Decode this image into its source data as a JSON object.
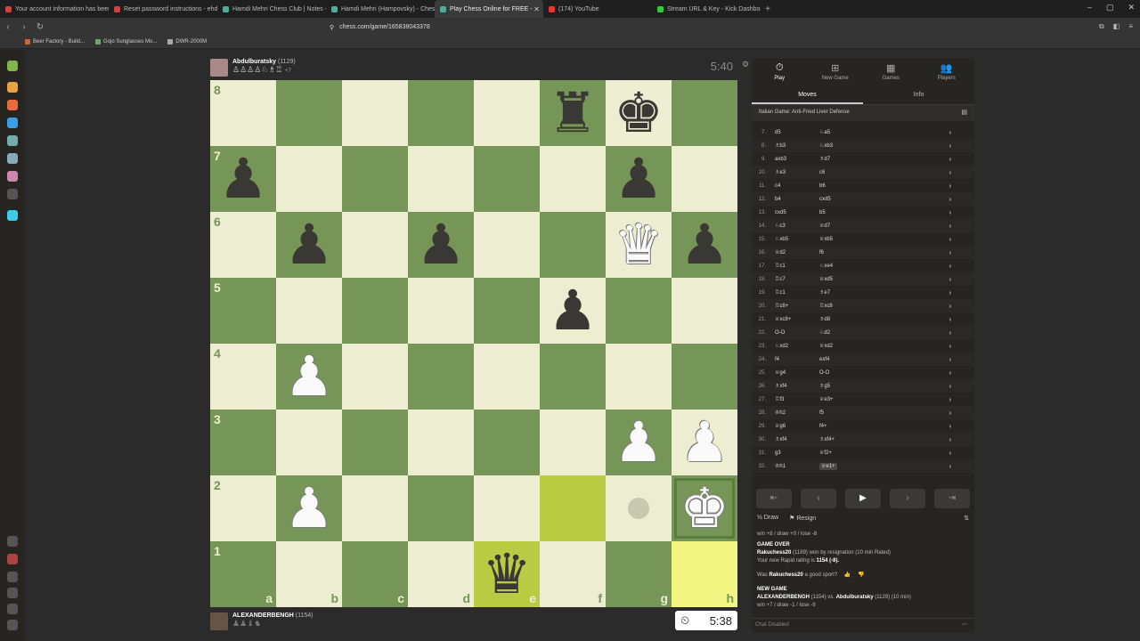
{
  "tabs": [
    {
      "label": "Your account information has been c",
      "color": "#c44"
    },
    {
      "label": "Reset password instructions - ehdi",
      "color": "#c44"
    },
    {
      "label": "Hamdi Mehri Chess Club | Notes - C",
      "color": "#5a9"
    },
    {
      "label": "Hamdi Mehri (Hampovsky) - Chess.",
      "color": "#5a9"
    },
    {
      "label": "Play Chess Online for FREE -",
      "color": "#5a9",
      "active": true
    },
    {
      "label": "(174) YouTube",
      "color": "#e33"
    },
    {
      "label": "Stream URL & Key - Kick Dashboard",
      "color": "#3c3"
    }
  ],
  "address": {
    "url": "chess.com/game/165838043378"
  },
  "bookmarks": [
    {
      "label": "Beer Factory - Build...",
      "color": "#c63"
    },
    {
      "label": "Gojo Sunglasses Mo...",
      "color": "#6a6"
    },
    {
      "label": "DWR-2000M",
      "color": "#aaa"
    }
  ],
  "top_player": {
    "name": "Abdulburatsky",
    "rating": "(1129)",
    "captured": "♙♙♙♙♘♗♖",
    "material": "+7",
    "clock": "5:40"
  },
  "bottom_player": {
    "name": "ALEXANDERBENGH",
    "rating": "(1154)",
    "captured": "♟♟♝♞",
    "clock": "5:38"
  },
  "board": {
    "files": [
      "a",
      "b",
      "c",
      "d",
      "e",
      "f",
      "g",
      "h"
    ],
    "ranks": [
      "8",
      "7",
      "6",
      "5",
      "4",
      "3",
      "2",
      "1"
    ],
    "position": [
      [
        "",
        "",
        "",
        "",
        "",
        "r",
        "k",
        ""
      ],
      [
        "p",
        "",
        "",
        "",
        "",
        "",
        "p",
        ""
      ],
      [
        "",
        "p",
        "",
        "p",
        "",
        "",
        "Q",
        "p"
      ],
      [
        "",
        "",
        "",
        "",
        "",
        "p",
        "",
        ""
      ],
      [
        "",
        "P",
        "",
        "",
        "",
        "",
        "",
        ""
      ],
      [
        "",
        "",
        "",
        "",
        "",
        "",
        "P",
        "P"
      ],
      [
        "",
        "P",
        "",
        "",
        "",
        "",
        "",
        "K"
      ],
      [
        "",
        "",
        "",
        "",
        "q",
        "",
        "",
        ""
      ]
    ],
    "highlights": [
      "f2",
      "e1",
      "h1"
    ],
    "check_square": "h2",
    "move_dot": "g2"
  },
  "panel": {
    "tabs": [
      {
        "label": "Play",
        "icon": "⏱"
      },
      {
        "label": "New Game",
        "icon": "⊞"
      },
      {
        "label": "Games",
        "icon": "▦"
      },
      {
        "label": "Players",
        "icon": "👥"
      }
    ],
    "subtabs": [
      "Moves",
      "Info"
    ],
    "opening": "Italian Game: Anti-Fried Liver Defense",
    "moves": [
      {
        "n": "7.",
        "w": "d5",
        "b": "♘a5"
      },
      {
        "n": "8.",
        "w": "♗b3",
        "b": "♘xb3"
      },
      {
        "n": "9.",
        "w": "axb3",
        "b": "♗d7"
      },
      {
        "n": "10.",
        "w": "♗e3",
        "b": "c6"
      },
      {
        "n": "11.",
        "w": "c4",
        "b": "b6"
      },
      {
        "n": "12.",
        "w": "b4",
        "b": "cxd5"
      },
      {
        "n": "13.",
        "w": "cxd5",
        "b": "b5"
      },
      {
        "n": "14.",
        "w": "♘c3",
        "b": "♕d7"
      },
      {
        "n": "15.",
        "w": "♘xb5",
        "b": "♕xb5"
      },
      {
        "n": "16.",
        "w": "♕d2",
        "b": "f6"
      },
      {
        "n": "17.",
        "w": "♖c1",
        "b": "♘xe4"
      },
      {
        "n": "18.",
        "w": "♖c7",
        "b": "♕xd5"
      },
      {
        "n": "19.",
        "w": "♖c1",
        "b": "♗e7"
      },
      {
        "n": "20.",
        "w": "♖c8+",
        "b": "♖xc8"
      },
      {
        "n": "21.",
        "w": "♕xc8+",
        "b": "♗d8"
      },
      {
        "n": "22.",
        "w": "O-O",
        "b": "♘d2"
      },
      {
        "n": "23.",
        "w": "♘xd2",
        "b": "♕xd2"
      },
      {
        "n": "24.",
        "w": "f4",
        "b": "exf4"
      },
      {
        "n": "25.",
        "w": "♕g4",
        "b": "O-O"
      },
      {
        "n": "26.",
        "w": "♗xf4",
        "b": "♗g5"
      },
      {
        "n": "27.",
        "w": "♖f3",
        "b": "♕e3+"
      },
      {
        "n": "28.",
        "w": "♔h2",
        "b": "f5"
      },
      {
        "n": "29.",
        "w": "♕g6",
        "b": "f4+"
      },
      {
        "n": "30.",
        "w": "♗xf4",
        "b": "♗xf4+"
      },
      {
        "n": "31.",
        "w": "g3",
        "b": "♕f2+"
      },
      {
        "n": "32.",
        "w": "♔h1",
        "b": "♕e1+"
      }
    ],
    "nav": [
      "⇤",
      "‹",
      "▶",
      "›",
      "⇥"
    ],
    "draw_label": "½ Draw",
    "resign_label": "⚑ Resign",
    "flip_icon": "⇅",
    "info": {
      "win_line1": "win +8 / draw +0 / lose -8",
      "game_over": "GAME OVER",
      "result_winner": "Rakuchess20",
      "result_text": " (1189) won by resignation (10 min Rated)",
      "rating_text": "Your new Rapid rating is ",
      "rating_value": "1154 (-8).",
      "sport_prefix": "Was ",
      "sport_name": "Rakuchess20",
      "sport_suffix": " a good sport?",
      "new_game": "NEW GAME",
      "ng_white": "ALEXANDERBENGH",
      "ng_mid": " (1154) vs. ",
      "ng_black": "Abdulburatsky",
      "ng_suffix": " (1129) (10 min)",
      "win_line2": "win +7 / draw -1 / lose -9"
    },
    "chat": "Chat Disabled"
  }
}
